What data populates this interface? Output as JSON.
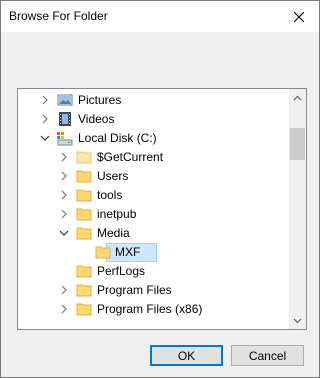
{
  "dialog": {
    "title": "Browse For Folder",
    "ok_label": "OK",
    "cancel_label": "Cancel"
  },
  "tree": {
    "items": [
      {
        "label": "Pictures",
        "icon": "pictures-icon",
        "expander": "collapsed"
      },
      {
        "label": "Videos",
        "icon": "videos-icon",
        "expander": "collapsed"
      },
      {
        "label": "Local Disk (C:)",
        "icon": "drive-icon",
        "expander": "expanded"
      },
      {
        "label": "$GetCurrent",
        "icon": "folder-icon",
        "expander": "collapsed"
      },
      {
        "label": "Users",
        "icon": "folder-icon",
        "expander": "collapsed"
      },
      {
        "label": "tools",
        "icon": "folder-icon",
        "expander": "collapsed"
      },
      {
        "label": "inetpub",
        "icon": "folder-icon",
        "expander": "collapsed"
      },
      {
        "label": "Media",
        "icon": "folder-icon",
        "expander": "expanded"
      },
      {
        "label": "MXF",
        "icon": "folder-icon",
        "expander": "none",
        "selected": true
      },
      {
        "label": "PerfLogs",
        "icon": "folder-icon",
        "expander": "none"
      },
      {
        "label": "Program Files",
        "icon": "folder-icon",
        "expander": "collapsed"
      },
      {
        "label": "Program Files (x86)",
        "icon": "folder-icon",
        "expander": "collapsed"
      }
    ]
  },
  "colors": {
    "selection": "#cce8ff",
    "folder": "#ffd76e",
    "accent": "#0078d7"
  }
}
